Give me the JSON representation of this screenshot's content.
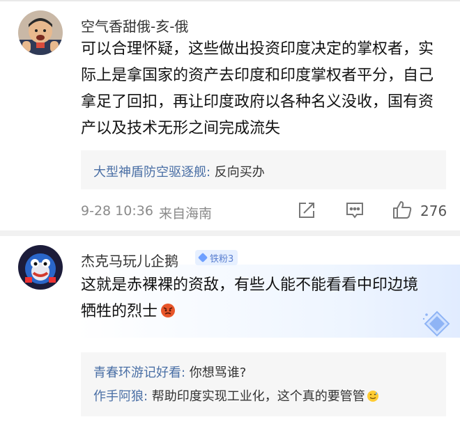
{
  "comments": [
    {
      "username": "空气香甜俄-亥-俄",
      "text_lines": [
        "可以合理怀疑，这些做出投资印度决定的掌权者，实",
        "际上是拿国家的资产去印度和印度掌权者平分，自己",
        "拿足了回扣，再让印度政府以各种名义没收，国有资",
        "产以及技术无形之间完成流失"
      ],
      "reply": {
        "user": "大型神盾防空驱逐舰:",
        "text": " 反向买办"
      },
      "time": "9-28 10:36",
      "location": "来自海南",
      "like_count": "276",
      "icons": [
        "share-icon",
        "comment-icon",
        "like-icon"
      ]
    },
    {
      "username": "杰克马玩儿企鹅",
      "badge": "铁粉3",
      "text_lines": [
        "这就是赤裸裸的资敌，有些人能不能看看中印边境",
        "牺牲的烈士"
      ],
      "emoji_icon": "angry-face-icon",
      "replies": [
        {
          "user": "青春环游记好看:",
          "text": " 你想骂谁?"
        },
        {
          "user": "作手阿狼:",
          "text": " 帮助印度实现工业化，这个真的要管管",
          "emoji_icon": "sweat-smile-icon"
        }
      ]
    }
  ],
  "colors": {
    "username_link": "#4a6fa5",
    "meta_gray": "#8a8a8a",
    "badge_bg": "#e7f0ff",
    "badge_text": "#5a7fd0"
  }
}
